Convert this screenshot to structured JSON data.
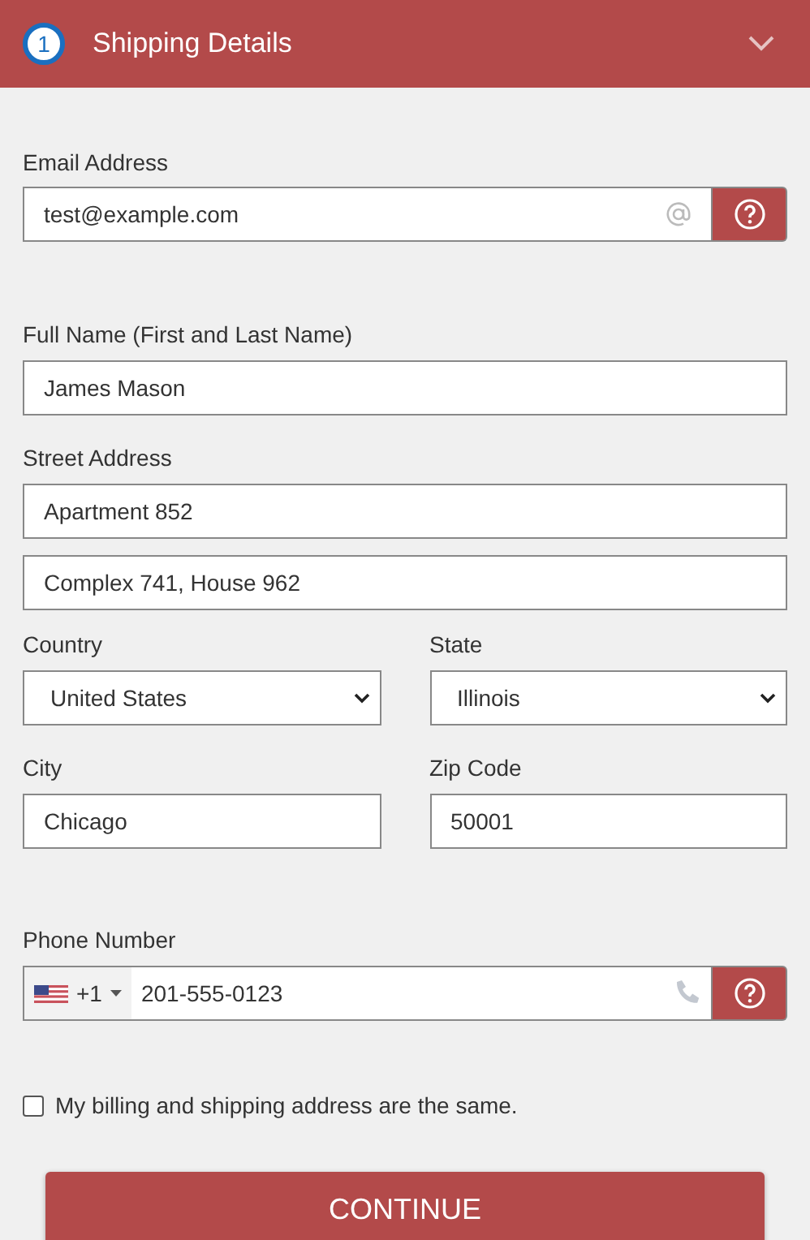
{
  "header": {
    "step": "1",
    "title": "Shipping Details"
  },
  "email": {
    "label": "Email Address",
    "value": "test@example.com"
  },
  "full_name": {
    "label": "Full Name (First and Last Name)",
    "value": "James Mason"
  },
  "street": {
    "label": "Street Address",
    "line_1": "Apartment 852",
    "line_2": "Complex 741, House 962"
  },
  "country": {
    "label": "Country",
    "value": "United States"
  },
  "state": {
    "label": "State",
    "value": "Illinois"
  },
  "city": {
    "label": "City",
    "value": "Chicago"
  },
  "zip": {
    "label": "Zip Code",
    "value": "50001"
  },
  "phone": {
    "label": "Phone Number",
    "dial_code": "+1",
    "value": "201-555-0123"
  },
  "same_address": {
    "label": "My billing and shipping address are the same.",
    "checked": false
  },
  "continue_button": "CONTINUE"
}
